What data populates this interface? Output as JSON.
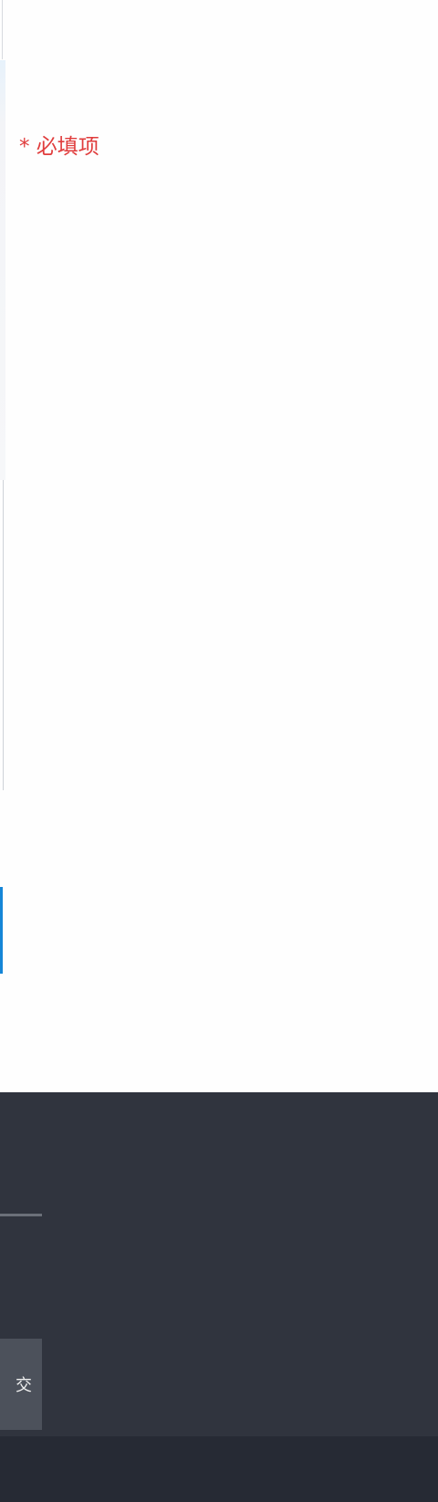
{
  "form": {
    "required_note": "* 必填项"
  },
  "footer": {
    "submit_partial_label": "交"
  }
}
